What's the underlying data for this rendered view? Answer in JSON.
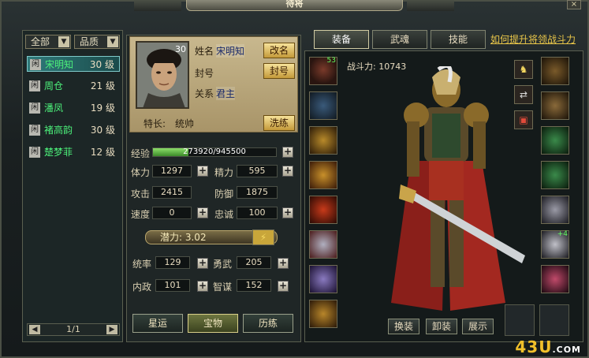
{
  "window": {
    "title": "待将",
    "close": "×"
  },
  "filters": {
    "faction": "全部",
    "quality": "品质"
  },
  "generals": [
    {
      "status": "闲",
      "name": "宋明知",
      "level": "30",
      "unit": "级"
    },
    {
      "status": "闲",
      "name": "周仓",
      "level": "21",
      "unit": "级"
    },
    {
      "status": "闲",
      "name": "潘凤",
      "level": "19",
      "unit": "级"
    },
    {
      "status": "闲",
      "name": "褚高韵",
      "level": "30",
      "unit": "级"
    },
    {
      "status": "闲",
      "name": "楚梦菲",
      "level": "12",
      "unit": "级"
    }
  ],
  "pager": {
    "text": "1/1",
    "prev": "◀",
    "next": "▶"
  },
  "profile": {
    "portrait_level": "30",
    "name_label": "姓名",
    "name": "宋明知",
    "title_label": "封号",
    "title_value": "",
    "relation_label": "关系",
    "relation_value": "君主",
    "rename_button": "改名",
    "title_button": "封号",
    "specialty_label": "特长:",
    "specialty_value": "统帅",
    "wash_button": "洗练"
  },
  "exp": {
    "label": "经验",
    "text": "273920/945500",
    "progress": 0.29
  },
  "stats": {
    "stamina_label": "体力",
    "stamina": "1297",
    "energy_label": "精力",
    "energy": "595",
    "attack_label": "攻击",
    "attack": "2415",
    "defense_label": "防御",
    "defense": "1875",
    "speed_label": "速度",
    "speed": "0",
    "loyalty_label": "忠诚",
    "loyalty": "100"
  },
  "potential": {
    "label": "潜力: 3.02"
  },
  "attributes": {
    "command_label": "统率",
    "command": "129",
    "valor_label": "勇武",
    "valor": "205",
    "politics_label": "内政",
    "politics": "101",
    "wisdom_label": "智谋",
    "wisdom": "152"
  },
  "bottom_buttons": {
    "stars": "星运",
    "treasure": "宝物",
    "training": "历练"
  },
  "tabs": {
    "equipment": "装备",
    "soul": "武魂",
    "skill": "技能"
  },
  "tip_link": "如何提升将领战斗力",
  "power": {
    "label": "战斗力:",
    "value": "10743"
  },
  "equip_badges": {
    "helmet": "53",
    "sword": "+4"
  },
  "actions": {
    "change": "换装",
    "unequip": "卸装",
    "show": "展示"
  },
  "watermark": {
    "main": "43U",
    "suffix": ".COM"
  }
}
